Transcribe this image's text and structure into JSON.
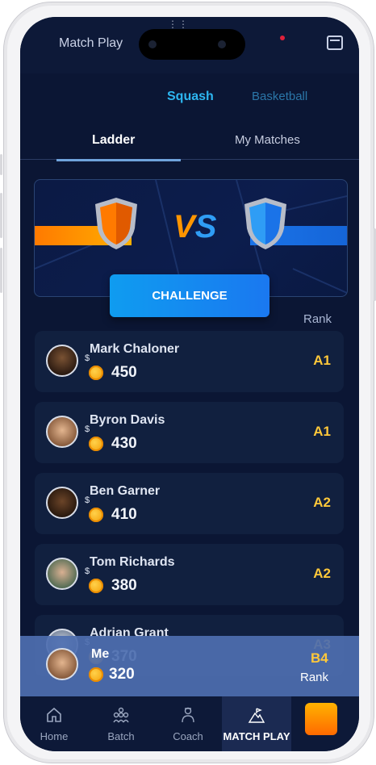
{
  "app": {
    "title": "Match Play"
  },
  "sports": [
    {
      "label": "Squash",
      "active": true
    },
    {
      "label": "Basketball",
      "active": false
    }
  ],
  "tabs": [
    {
      "label": "Ladder",
      "active": true
    },
    {
      "label": "My Matches",
      "active": false
    }
  ],
  "banner": {
    "vs_v": "V",
    "vs_s": "S",
    "challenge_label": "CHALLENGE"
  },
  "rank_header": "Rank",
  "players": [
    {
      "name": "Mark Chaloner",
      "currency": "$",
      "points": "450",
      "rank": "A1"
    },
    {
      "name": "Byron Davis",
      "currency": "$",
      "points": "430",
      "rank": "A1"
    },
    {
      "name": "Ben Garner",
      "currency": "$",
      "points": "410",
      "rank": "A2"
    },
    {
      "name": "Tom Richards",
      "currency": "$",
      "points": "380",
      "rank": "A2"
    },
    {
      "name": "Adrian Grant",
      "currency": "$",
      "points": "370",
      "rank": "A3"
    }
  ],
  "me": {
    "name": "Me",
    "currency": "$",
    "points": "320",
    "rank": "B4",
    "rank_label": "Rank"
  },
  "nav": [
    {
      "label": "Home",
      "icon": "home-icon",
      "active": false
    },
    {
      "label": "Batch",
      "icon": "batch-icon",
      "active": false
    },
    {
      "label": "Coach",
      "icon": "coach-icon",
      "active": false
    },
    {
      "label": "MATCH PLAY",
      "icon": "mountain-flag-icon",
      "active": true
    }
  ],
  "colors": {
    "accent": "#2db6f0",
    "rank": "#ffc83a",
    "background": "#0b1634",
    "orange": "#ff7a00",
    "blue": "#1a73e8"
  }
}
